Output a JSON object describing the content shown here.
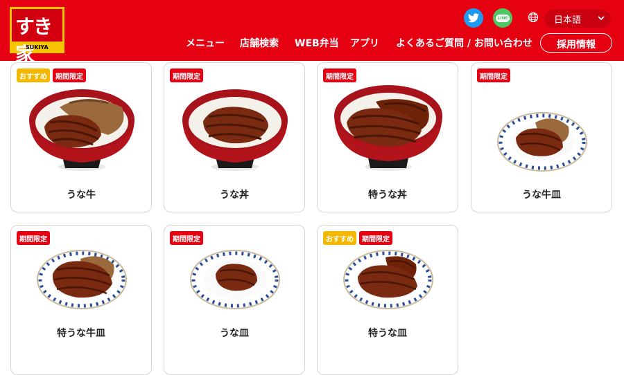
{
  "header": {
    "logo_text": "すき家",
    "logo_sub": "SUKIYA",
    "language": "日本語",
    "nav": [
      "メニュー",
      "店舗検索",
      "WEB弁当",
      "アプリ",
      "よくあるご質問 / お問い合わせ"
    ],
    "recruit": "採用情報",
    "line_label": "LINE",
    "colors": {
      "brand_red": "#e50012",
      "accent_yellow": "#f6c400"
    }
  },
  "tags": {
    "recommend": "おすすめ",
    "limited": "期間限定"
  },
  "menu": [
    {
      "name": "うな牛",
      "tags": [
        "おすすめ",
        "期間限定"
      ],
      "icon": "bowl-eel-beef"
    },
    {
      "name": "うな丼",
      "tags": [
        "期間限定"
      ],
      "icon": "bowl-eel"
    },
    {
      "name": "特うな丼",
      "tags": [
        "期間限定"
      ],
      "icon": "bowl-eel-large"
    },
    {
      "name": "うな牛皿",
      "tags": [
        "期間限定"
      ],
      "icon": "plate-eel-beef"
    },
    {
      "name": "特うな牛皿",
      "tags": [
        "期間限定"
      ],
      "icon": "plate-eel-beef-large"
    },
    {
      "name": "うな皿",
      "tags": [
        "期間限定"
      ],
      "icon": "plate-eel"
    },
    {
      "name": "特うな皿",
      "tags": [
        "おすすめ",
        "期間限定"
      ],
      "icon": "plate-eel-large"
    }
  ]
}
